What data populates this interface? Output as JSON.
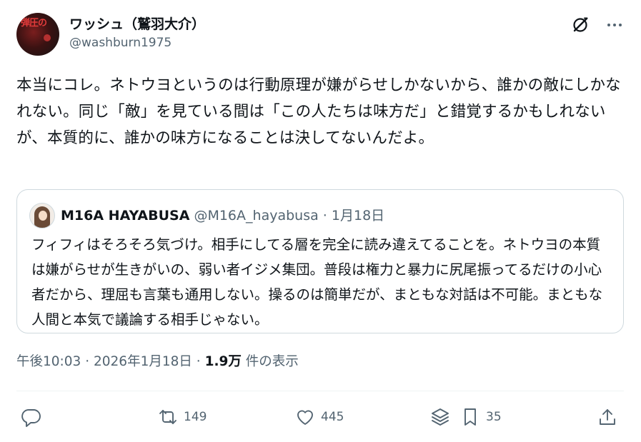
{
  "post": {
    "author": {
      "display_name": "ワッシュ（鷲羽大介）",
      "handle": "@washburn1975",
      "avatar_text": "弾圧の"
    },
    "text": "本当にコレ。ネトウヨというのは行動原理が嫌がらせしかないから、誰かの敵にしかなれない。同じ「敵」を見ている間は「この人たちは味方だ」と錯覚するかもしれないが、本質的に、誰かの味方になることは決してないんだよ。",
    "icons": {
      "grok": "grok-icon",
      "more": "more-options-icon"
    }
  },
  "quote": {
    "display_name": "M16A HAYABUSA",
    "handle": "@M16A_hayabusa",
    "separator": "·",
    "date": "1月18日",
    "text": "フィフィはそろそろ気づけ。相手にしてる層を完全に読み違えてることを。ネトウヨの本質は嫌がらせが生きがいの、弱い者イジメ集団。普段は権力と暴力に尻尾振ってるだけの小心者だから、理屈も言葉も通用しない。操るのは簡単だが、まともな対話は不可能。まともな人間と本気で議論する相手じゃない。"
  },
  "meta": {
    "time": "午後10:03",
    "sep1": "·",
    "date": "2026年1月18日",
    "sep2": "·",
    "views": "1.9万",
    "views_label": "件の表示"
  },
  "actions": {
    "reply": {
      "icon": "reply-icon",
      "count": ""
    },
    "repost": {
      "icon": "repost-icon",
      "count": "149"
    },
    "like": {
      "icon": "heart-icon",
      "count": "445"
    },
    "layers": {
      "icon": "layers-icon",
      "count": ""
    },
    "bookmark": {
      "icon": "bookmark-icon",
      "count": "35"
    },
    "share": {
      "icon": "share-icon",
      "count": ""
    }
  },
  "colors": {
    "text": "#0f1419",
    "secondary": "#536471",
    "border": "#cfd9de"
  }
}
